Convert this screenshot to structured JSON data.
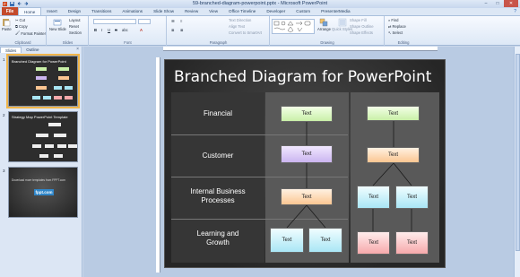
{
  "window": {
    "title": "59-branched-diagram-powerpoint.pptx - Microsoft PowerPoint",
    "controls": [
      "–",
      "□",
      "✕"
    ]
  },
  "tabs": [
    "File",
    "Home",
    "Insert",
    "Design",
    "Transitions",
    "Animations",
    "Slide Show",
    "Review",
    "View",
    "Office Timeline",
    "Developer",
    "Custom",
    "PresenterMedia"
  ],
  "active_tab": "Home",
  "ribbon": {
    "clipboard": {
      "label": "Clipboard",
      "paste": "Paste",
      "cut": "Cut",
      "copy": "Copy",
      "format_painter": "Format Painter"
    },
    "slides": {
      "label": "Slides",
      "new_slide": "New Slide",
      "layout": "Layout",
      "reset": "Reset",
      "section": "Section"
    },
    "font": {
      "label": "Font",
      "bold": "B",
      "italic": "I",
      "underline": "U",
      "strike": "S",
      "shadow": "abc"
    },
    "paragraph": {
      "label": "Paragraph",
      "text_direction": "Text Direction",
      "align_text": "Align Text",
      "convert_smartart": "Convert to SmartArt"
    },
    "drawing": {
      "label": "Drawing",
      "arrange": "Arrange",
      "quick_styles": "Quick Styles",
      "shape_fill": "Shape Fill",
      "shape_outline": "Shape Outline",
      "shape_effects": "Shape Effects"
    },
    "editing": {
      "label": "Editing",
      "find": "Find",
      "replace": "Replace",
      "select": "Select"
    }
  },
  "left_panel": {
    "tabs": [
      "Slides",
      "Outline"
    ],
    "close": "×",
    "thumbnails": [
      {
        "num": "1",
        "title": "Branched Diagram for PowerPoint",
        "selected": true
      },
      {
        "num": "2",
        "title": "Strategy Map PowerPoint Template",
        "selected": false
      },
      {
        "num": "3",
        "title": "Download more templates from FPPT.com",
        "logo": "fppt.com",
        "selected": false
      }
    ]
  },
  "slide": {
    "title": "Branched Diagram for PowerPoint",
    "rows": [
      "Financial",
      "Customer",
      "Internal Business Processes",
      "Learning and Growth"
    ],
    "node_text": "Text"
  },
  "colors": {
    "file_tab": "#c44b2c",
    "slide_bg": "#2d2d2d",
    "green": "#c9f0a8",
    "purple": "#cbb5f0",
    "orange": "#fbc692",
    "cyan": "#a9e6f5",
    "pink": "#f6a9ab"
  }
}
